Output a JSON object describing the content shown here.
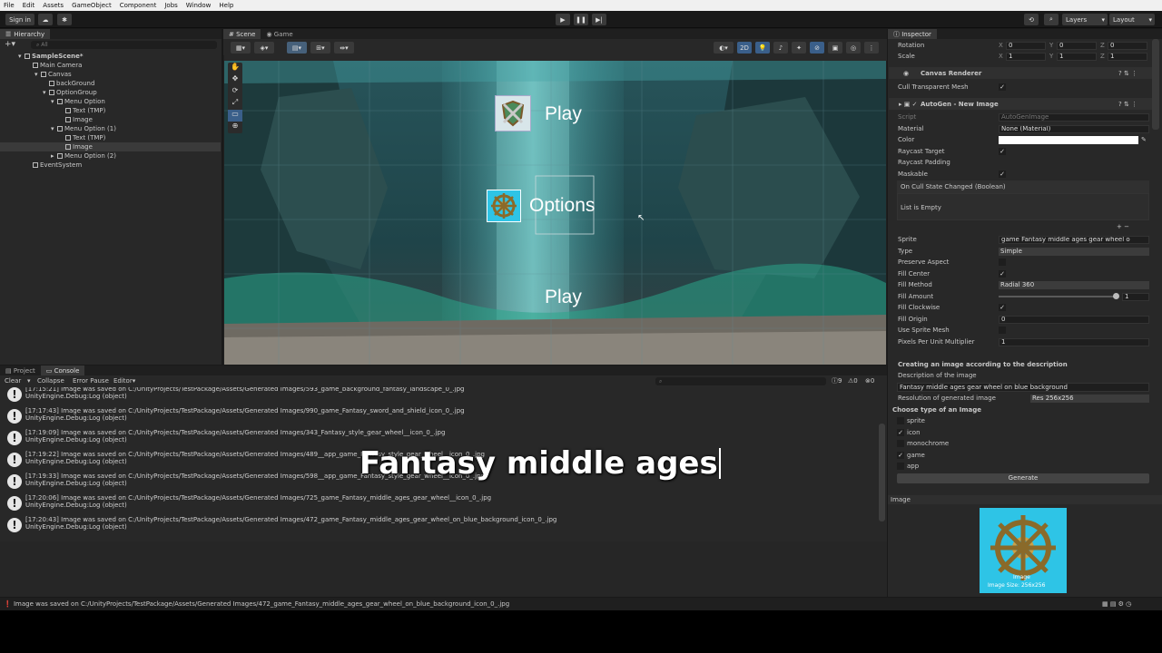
{
  "menu": [
    "File",
    "Edit",
    "Assets",
    "GameObject",
    "Component",
    "Jobs",
    "Window",
    "Help"
  ],
  "toolbar": {
    "sign_in": "Sign in",
    "layers": "Layers",
    "layout": "Layout"
  },
  "hierarchy": {
    "tab": "Hierarchy",
    "search_placeholder": "All",
    "items": [
      {
        "label": "SampleScene*"
      },
      {
        "label": "Main Camera"
      },
      {
        "label": "Canvas"
      },
      {
        "label": "backGround"
      },
      {
        "label": "OptionGroup"
      },
      {
        "label": "Menu Option"
      },
      {
        "label": "Text (TMP)"
      },
      {
        "label": "Image"
      },
      {
        "label": "Menu Option (1)"
      },
      {
        "label": "Text (TMP)"
      },
      {
        "label": "Image"
      },
      {
        "label": "Menu Option (2)"
      },
      {
        "label": "EventSystem"
      }
    ]
  },
  "scene": {
    "tab_scene": "Scene",
    "tab_game": "Game",
    "mode_2d": "2D",
    "ui_play_top": "Play",
    "ui_options": "Options",
    "ui_play_bottom": "Play"
  },
  "bottom": {
    "tab_project": "Project",
    "tab_console": "Console",
    "clear": "Clear",
    "collapse": "Collapse",
    "error_pause": "Error Pause",
    "editor": "Editor",
    "counts": {
      "log": "9",
      "warn": "0",
      "err": "0"
    },
    "logs": [
      {
        "line1": "[17:15:21] Image was saved on C:/UnityProjects/TestPackage/Assets/Generated Images/593_game_background_fantasy_landscape_0_.jpg",
        "line2": "UnityEngine.Debug:Log (object)"
      },
      {
        "line1": "[17:17:43] Image was saved on C:/UnityProjects/TestPackage/Assets/Generated Images/990_game_Fantasy_sword_and_shield_icon_0_.jpg",
        "line2": "UnityEngine.Debug:Log (object)"
      },
      {
        "line1": "[17:19:09] Image was saved on C:/UnityProjects/TestPackage/Assets/Generated Images/343_Fantasy_style_gear_wheel__icon_0_.jpg",
        "line2": "UnityEngine.Debug:Log (object)"
      },
      {
        "line1": "[17:19:22] Image was saved on C:/UnityProjects/TestPackage/Assets/Generated Images/489__app_game_Fantasy_style_gear_wheel__icon_0_.jpg",
        "line2": "UnityEngine.Debug:Log (object)"
      },
      {
        "line1": "[17:19:33] Image was saved on C:/UnityProjects/TestPackage/Assets/Generated Images/598__app_game_Fantasy_style_gear_wheel__icon_0_.jpg",
        "line2": "UnityEngine.Debug:Log (object)"
      },
      {
        "line1": "[17:20:06] Image was saved on C:/UnityProjects/TestPackage/Assets/Generated Images/725_game_Fantasy_middle_ages_gear_wheel__icon_0_.jpg",
        "line2": "UnityEngine.Debug:Log (object)"
      },
      {
        "line1": "[17:20:43] Image was saved on C:/UnityProjects/TestPackage/Assets/Generated Images/472_game_Fantasy_middle_ages_gear_wheel_on_blue_background_icon_0_.jpg",
        "line2": "UnityEngine.Debug:Log (object)"
      }
    ],
    "caption": "Fantasy middle ages"
  },
  "status": {
    "text": "Image was saved on C:/UnityProjects/TestPackage/Assets/Generated Images/472_game_Fantasy_middle_ages_gear_wheel_on_blue_background_icon_0_.jpg"
  },
  "inspector": {
    "tab": "Inspector",
    "rotation": {
      "label": "Rotation",
      "x": "0",
      "y": "0",
      "z": "0"
    },
    "scale": {
      "label": "Scale",
      "x": "1",
      "y": "1",
      "z": "1"
    },
    "xyz": [
      "X",
      "Y",
      "Z"
    ],
    "canvas_renderer": {
      "title": "Canvas Renderer",
      "cull_label": "Cull Transparent Mesh"
    },
    "autogen": {
      "title": "AutoGen - New Image",
      "script_label": "Script",
      "script_value": "AutoGenImage",
      "material_label": "Material",
      "material_value": "None (Material)",
      "color_label": "Color",
      "raycast_target": "Raycast Target",
      "raycast_padding": "Raycast Padding",
      "maskable": "Maskable",
      "event_title": "On Cull State Changed (Boolean)",
      "event_empty": "List is Empty",
      "sprite_label": "Sprite",
      "sprite_value": "game Fantasy middle ages gear wheel o",
      "type_label": "Type",
      "type_value": "Simple",
      "preserve_aspect": "Preserve Aspect",
      "fill_center": "Fill Center",
      "fill_method_label": "Fill Method",
      "fill_method_value": "Radial 360",
      "fill_amount_label": "Fill Amount",
      "fill_amount_value": "1",
      "fill_clockwise": "Fill Clockwise",
      "fill_origin_label": "Fill Origin",
      "fill_origin_value": "0",
      "use_sprite_mesh": "Use Sprite Mesh",
      "ppu_label": "Pixels Per Unit Multiplier",
      "ppu_value": "1",
      "creating_title": "Creating an image according to the description",
      "desc_label": "Description of the image",
      "desc_value": "Fantasy middle ages gear wheel on blue background",
      "res_label": "Resolution of generated image",
      "res_value": "Res 256x256",
      "choose_type": "Choose type of an Image",
      "types": [
        {
          "label": "sprite",
          "checked": false
        },
        {
          "label": "icon",
          "checked": true
        },
        {
          "label": "monochrome",
          "checked": false
        },
        {
          "label": "game",
          "checked": true
        },
        {
          "label": "app",
          "checked": false
        }
      ],
      "generate": "Generate"
    },
    "preview": {
      "header": "Image",
      "caption1": "Image",
      "caption2": "Image Size: 256x256"
    }
  }
}
